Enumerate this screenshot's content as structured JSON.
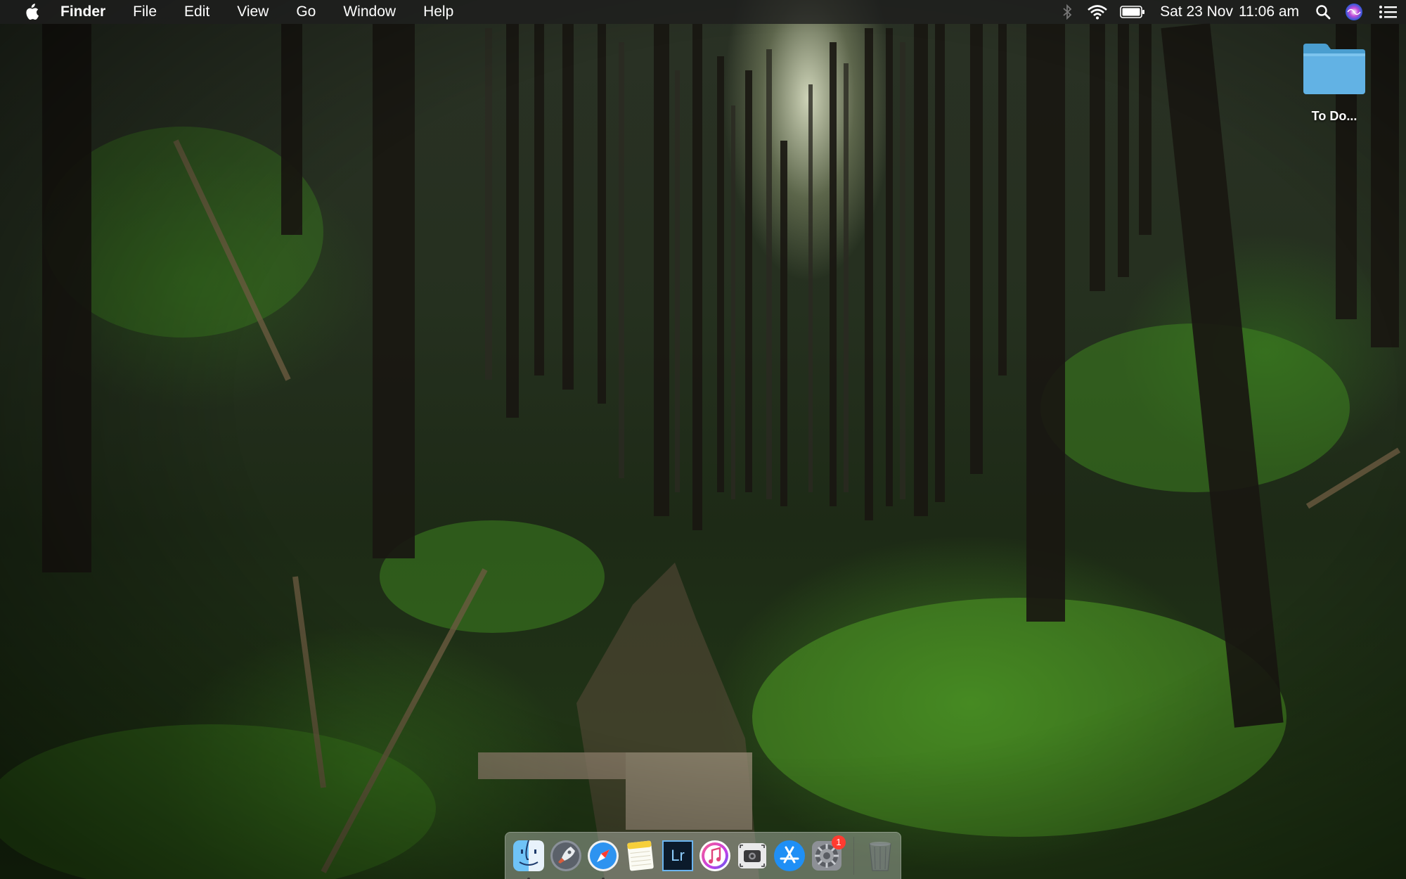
{
  "menubar": {
    "apple_icon": "apple-logo-icon",
    "app_name": "Finder",
    "menus": [
      "File",
      "Edit",
      "View",
      "Go",
      "Window",
      "Help"
    ],
    "status_icons": [
      "bluetooth-icon",
      "wifi-icon",
      "battery-icon",
      "spotlight-search-icon",
      "siri-icon",
      "notification-center-icon"
    ],
    "date": "Sat 23 Nov",
    "time": "11:06 am"
  },
  "desktop": {
    "folder": {
      "label": "To Do...",
      "icon": "folder-icon",
      "color": "#5fb0e0"
    }
  },
  "dock": {
    "apps": [
      {
        "name": "Finder",
        "icon": "finder-icon",
        "running": true
      },
      {
        "name": "Launchpad",
        "icon": "launchpad-icon",
        "running": false
      },
      {
        "name": "Safari",
        "icon": "safari-icon",
        "running": true
      },
      {
        "name": "Notes",
        "icon": "notes-icon",
        "running": false
      },
      {
        "name": "Lightroom",
        "icon": "lightroom-icon",
        "label": "Lr",
        "running": false
      },
      {
        "name": "iTunes",
        "icon": "itunes-icon",
        "running": false
      },
      {
        "name": "Screenshot",
        "icon": "screenshot-icon",
        "running": false
      },
      {
        "name": "App Store",
        "icon": "app-store-icon",
        "running": false
      },
      {
        "name": "System Preferences",
        "icon": "system-preferences-icon",
        "running": false,
        "badge": "1"
      }
    ],
    "trash": {
      "name": "Trash",
      "icon": "trash-icon"
    }
  }
}
